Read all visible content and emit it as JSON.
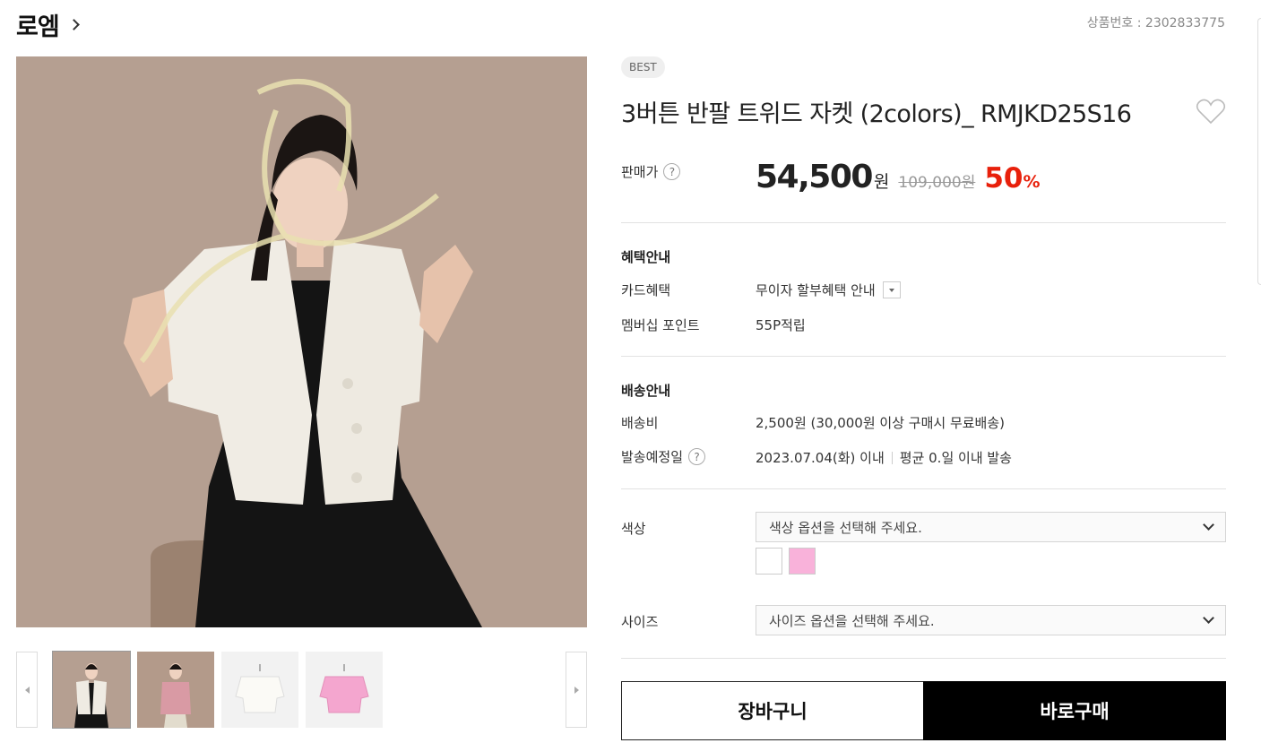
{
  "header": {
    "brand": "로엠",
    "product_no_label": "상품번호 : ",
    "product_no": "2302833775"
  },
  "product": {
    "badge": "BEST",
    "title": "3버튼 반팔 트위드 자켓 (2colors)_ RMJKD25S16",
    "price_label": "판매가",
    "sale_price": "54,500",
    "currency": "원",
    "original_price": "109,000원",
    "discount": "50",
    "discount_unit": "%"
  },
  "benefits": {
    "title": "혜택안내",
    "card_label": "카드혜택",
    "card_value": "무이자 할부혜택 안내",
    "point_label": "멤버십 포인트",
    "point_value": "55P적립"
  },
  "shipping": {
    "title": "배송안내",
    "fee_label": "배송비",
    "fee_value": "2,500원 (30,000원 이상 구매시 무료배송)",
    "date_label": "발송예정일",
    "date_value": "2023.07.04(화) 이내",
    "avg_value": "평균 0.일 이내 발송"
  },
  "options": {
    "color_label": "색상",
    "color_placeholder": "색상 옵션을 선택해 주세요.",
    "swatches": [
      "#ffffff",
      "#f9b2da"
    ],
    "size_label": "사이즈",
    "size_placeholder": "사이즈 옵션을 선택해 주세요."
  },
  "actions": {
    "cart": "장바구니",
    "buy": "바로구매"
  },
  "colors": {
    "discount": "#e8200b",
    "buy_bg": "#000000"
  }
}
